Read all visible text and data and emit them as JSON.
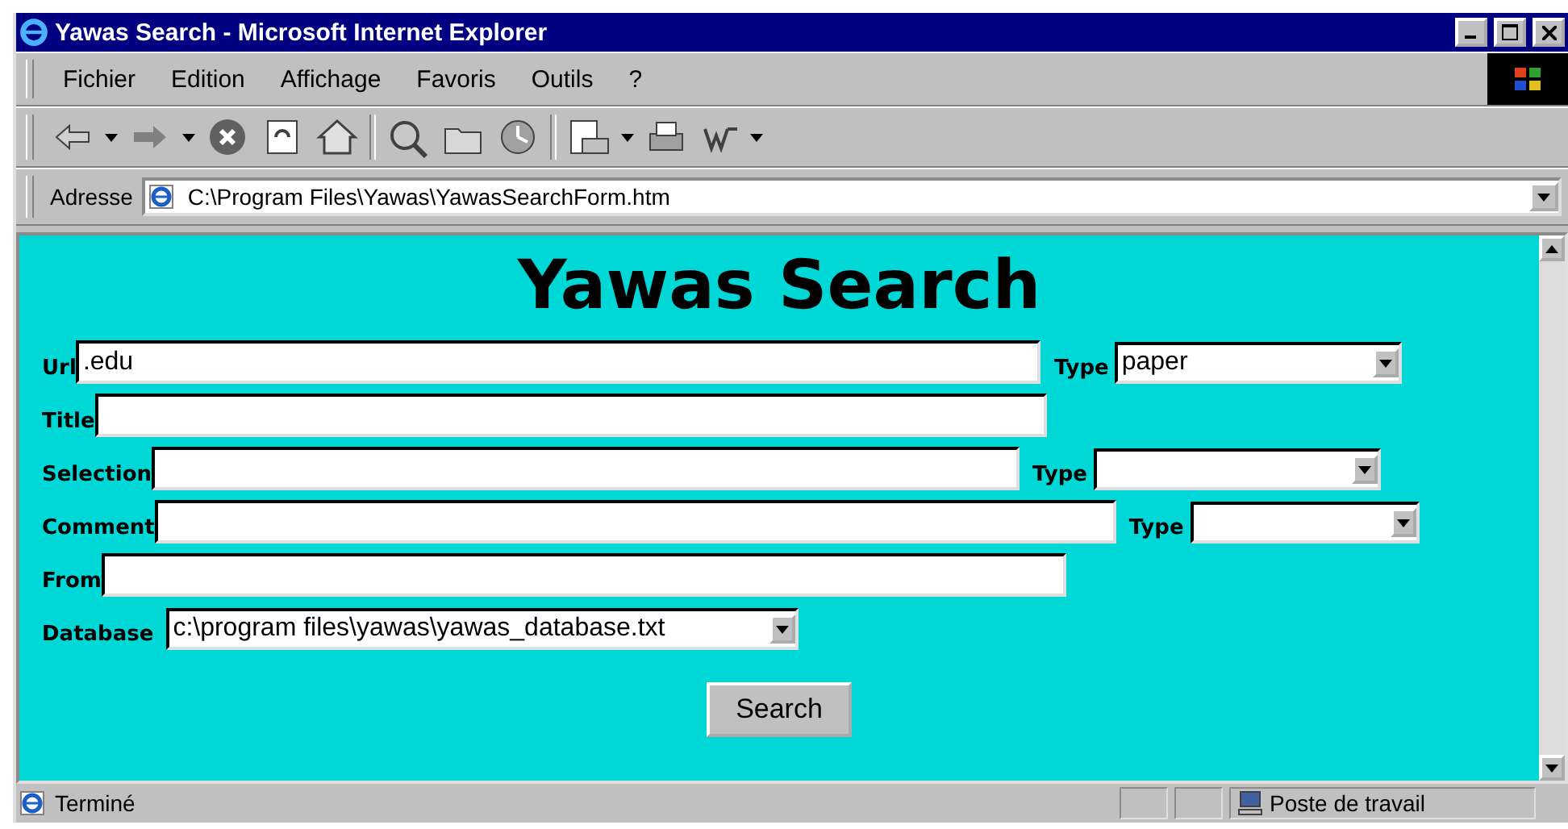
{
  "window": {
    "title": "Yawas Search - Microsoft Internet Explorer"
  },
  "menu": [
    "Fichier",
    "Edition",
    "Affichage",
    "Favoris",
    "Outils",
    "?"
  ],
  "address": {
    "label": "Adresse",
    "value": "C:\\Program Files\\Yawas\\YawasSearchForm.htm"
  },
  "page": {
    "heading": "Yawas Search",
    "rows": [
      {
        "kind": "text",
        "label": "Url",
        "value": ".edu",
        "type": {
          "label": "Type",
          "value": "paper"
        }
      },
      {
        "kind": "text",
        "label": "Title"
      },
      {
        "kind": "text",
        "label": "Selection",
        "type": {
          "label": "Type"
        }
      },
      {
        "kind": "text",
        "label": "Comment",
        "type": {
          "label": "Type"
        }
      },
      {
        "kind": "text",
        "label": "From"
      },
      {
        "kind": "select",
        "label": "Database",
        "value": "c:\\program files\\yawas\\yawas_database.txt"
      }
    ],
    "button": "Search"
  },
  "status_bar": {
    "text": "Terminé",
    "zone": "Poste de travail"
  }
}
